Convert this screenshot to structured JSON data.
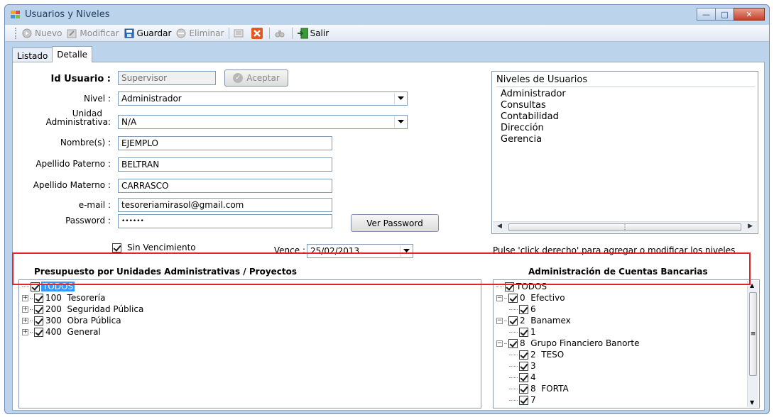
{
  "window": {
    "title": "Usuarios y Niveles"
  },
  "toolbar": {
    "nuevo": "Nuevo",
    "modificar": "Modificar",
    "guardar": "Guardar",
    "eliminar": "Eliminar",
    "salir": "Salir"
  },
  "tabs": {
    "listado": "Listado",
    "detalle": "Detalle"
  },
  "form": {
    "id_usuario_label": "Id Usuario :",
    "id_usuario_value": "Supervisor",
    "aceptar": "Aceptar",
    "nivel_label": "Nivel :",
    "nivel_value": "Administrador",
    "unidad_label_1": "Unidad",
    "unidad_label_2": "Administrativa:",
    "unidad_value": "N/A",
    "nombre_label": "Nombre(s) :",
    "nombre_value": "EJEMPLO",
    "ap_paterno_label": "Apellido Paterno :",
    "ap_paterno_value": "BELTRAN",
    "ap_materno_label": "Apellido Materno :",
    "ap_materno_value": "CARRASCO",
    "email_label": "e-mail :",
    "email_value": "tesoreriamirasol@gmail.com",
    "password_label": "Password :",
    "password_value": "••••••",
    "ver_password": "Ver Password",
    "sin_vencimiento": "Sin Vencimiento",
    "vence_label": "Vence :",
    "vence_value": "25/02/2013"
  },
  "niveles": {
    "header": "Niveles de Usuarios",
    "items": [
      "Administrador",
      "Consultas",
      "Contabilidad",
      "Dirección",
      "Gerencia"
    ],
    "hint": "Pulse 'click derecho' para agregar o modificar los niveles"
  },
  "presupuesto": {
    "title": "Presupuesto por Unidades Administrativas / Proyectos",
    "todos": "TODOS",
    "items": [
      "100  Tesorería",
      "200  Seguridad Pública",
      "300  Obra Pública",
      "400  General"
    ]
  },
  "cuentas": {
    "title": "Administración de Cuentas Bancarias",
    "todos": "TODOS",
    "efectivo": "0  Efectivo",
    "efectivo_child": "6",
    "banamex": "2  Banamex",
    "banamex_child": "1",
    "banorte": "8  Grupo Financiero Banorte",
    "banorte_children": [
      "2  TESO",
      "3",
      "4",
      "8  FORTA",
      "7"
    ]
  },
  "colors": {
    "highlight": "#e0252b",
    "selection": "#3399ff"
  },
  "icons": [
    "app-icon",
    "nuevo-icon",
    "modificar-icon",
    "guardar-icon",
    "eliminar-icon",
    "report-icon",
    "cancel-icon",
    "find-icon",
    "salir-icon",
    "check-icon",
    "chevron-down-icon"
  ]
}
